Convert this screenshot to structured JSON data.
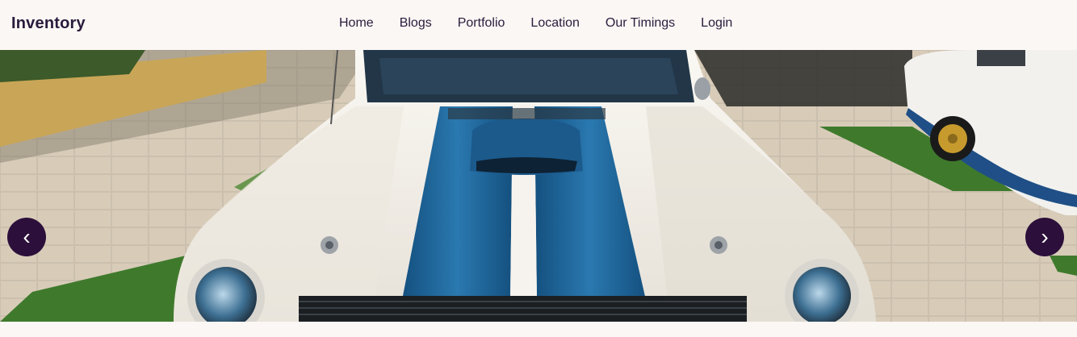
{
  "brand": {
    "name": "Inventory"
  },
  "nav": {
    "items": [
      {
        "label": "Home"
      },
      {
        "label": "Blogs"
      },
      {
        "label": "Portfolio"
      },
      {
        "label": "Location"
      },
      {
        "label": "Our Timings"
      },
      {
        "label": "Login"
      }
    ]
  },
  "carousel": {
    "prev_icon": "‹",
    "next_icon": "›",
    "slide_image": "classic-white-muscle-car-blue-racing-stripes"
  },
  "colors": {
    "nav_background": "#fbf7f4",
    "text_dark": "#2a1b3d",
    "arrow_background": "#2c0f3a",
    "stripe_blue": "#1f5f93",
    "car_white": "#f1eee8"
  }
}
